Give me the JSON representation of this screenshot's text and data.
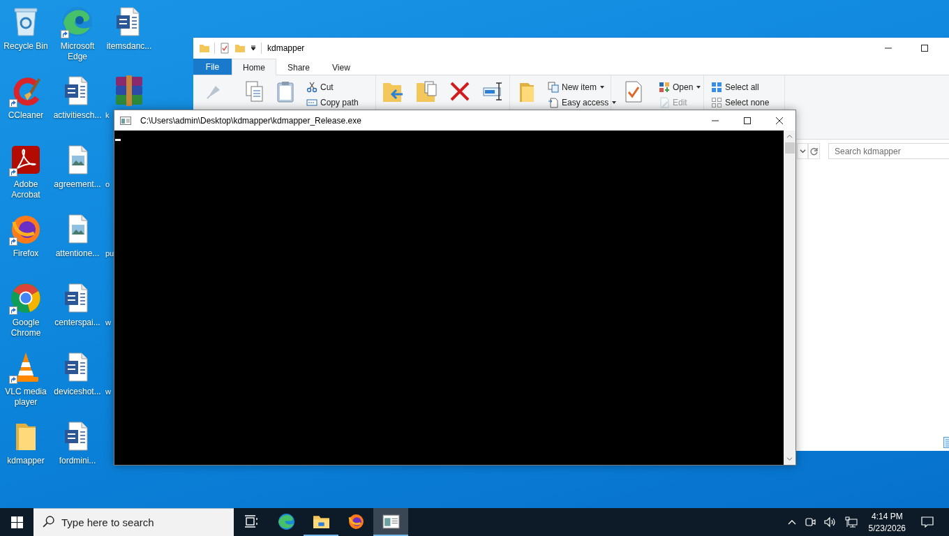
{
  "desktop_icons": [
    {
      "label": "Recycle Bin",
      "kind": "recycle",
      "shortcut": false,
      "covered": false
    },
    {
      "label": "CCleaner",
      "kind": "ccleaner",
      "shortcut": true,
      "covered": false
    },
    {
      "label": "Adobe Acrobat",
      "kind": "acrobat",
      "shortcut": true,
      "covered": false
    },
    {
      "label": "Firefox",
      "kind": "firefox",
      "shortcut": true,
      "covered": false
    },
    {
      "label": "Google Chrome",
      "kind": "chrome",
      "shortcut": true,
      "covered": false
    },
    {
      "label": "VLC media player",
      "kind": "vlc",
      "shortcut": true,
      "covered": false
    },
    {
      "label": "kdmapper",
      "kind": "folder",
      "shortcut": false,
      "covered": false
    },
    {
      "label": "Microsoft Edge",
      "kind": "edge",
      "shortcut": true,
      "covered": false
    },
    {
      "label": "activitiesch...",
      "kind": "word",
      "shortcut": false,
      "covered": false
    },
    {
      "label": "agreement...",
      "kind": "image",
      "shortcut": false,
      "covered": false
    },
    {
      "label": "attentione...",
      "kind": "image",
      "shortcut": false,
      "covered": false
    },
    {
      "label": "centerspai...",
      "kind": "word",
      "shortcut": false,
      "covered": false
    },
    {
      "label": "deviceshot...",
      "kind": "word",
      "shortcut": false,
      "covered": false
    },
    {
      "label": "fordmini...",
      "kind": "word",
      "shortcut": false,
      "covered": false
    },
    {
      "label": "itemsdanc...",
      "kind": "word",
      "shortcut": false,
      "covered": false
    },
    {
      "label": "k",
      "kind": "winrar",
      "shortcut": false,
      "covered": true
    },
    {
      "label": "o",
      "kind": "hidden",
      "covered": true
    },
    {
      "label": "pu",
      "kind": "hidden",
      "covered": true
    },
    {
      "label": "w",
      "kind": "hidden",
      "covered": true
    },
    {
      "label": "w",
      "kind": "hidden",
      "covered": true
    }
  ],
  "explorer": {
    "title": "kdmapper",
    "tabs": [
      {
        "label": "File",
        "kind": "file",
        "selected": false
      },
      {
        "label": "Home",
        "kind": "tab",
        "selected": true
      },
      {
        "label": "Share",
        "kind": "tab",
        "selected": false
      },
      {
        "label": "View",
        "kind": "tab",
        "selected": false
      }
    ],
    "clipboard": [
      {
        "label": "Cut",
        "dropdown": false,
        "disabled": false
      },
      {
        "label": "Copy path",
        "dropdown": false,
        "disabled": false
      }
    ],
    "new": [
      {
        "label": "New item",
        "dropdown": true,
        "disabled": false
      },
      {
        "label": "Easy access",
        "dropdown": true,
        "disabled": false
      }
    ],
    "open": [
      {
        "label": "Open",
        "dropdown": true,
        "disabled": false
      },
      {
        "label": "Edit",
        "dropdown": false,
        "disabled": true
      }
    ],
    "select": [
      {
        "label": "Select all",
        "dropdown": false,
        "disabled": false
      },
      {
        "label": "Select none",
        "dropdown": false,
        "disabled": false
      }
    ],
    "search": {
      "placeholder": "Search kdmapper"
    }
  },
  "console": {
    "title": "C:\\Users\\admin\\Desktop\\kdmapper\\kdmapper_Release.exe",
    "cursor_visible": true
  },
  "taskbar": {
    "search_placeholder": "Type here to search",
    "apps": [
      {
        "kind": "edge",
        "running": false,
        "selected": false
      },
      {
        "kind": "explorer",
        "running": true,
        "selected": false
      },
      {
        "kind": "firefox",
        "running": false,
        "selected": false
      },
      {
        "kind": "console",
        "running": true,
        "selected": true
      }
    ],
    "time": "4:14 PM",
    "date": "5/23/2026"
  }
}
